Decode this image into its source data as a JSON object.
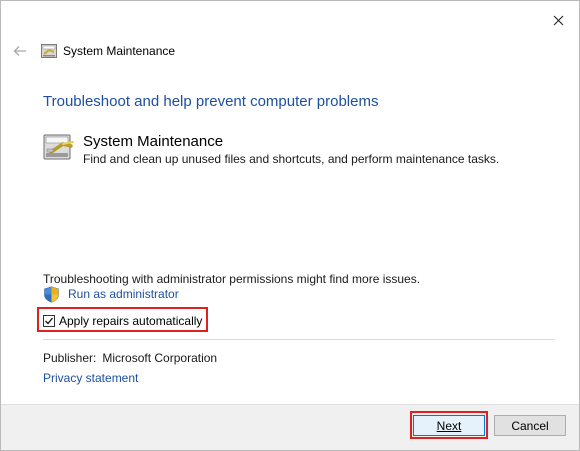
{
  "window": {
    "title": "System Maintenance",
    "close_icon": "close-icon",
    "back_icon": "back-arrow-icon"
  },
  "main": {
    "heading": "Troubleshoot and help prevent computer problems",
    "tool": {
      "name": "System Maintenance",
      "description": "Find and clean up unused files and shortcuts, and perform maintenance tasks.",
      "icon": "system-maintenance-icon"
    },
    "admin_note": "Troubleshooting with administrator permissions might find more issues.",
    "run_as_admin": "Run as administrator",
    "apply_repairs": {
      "label": "Apply repairs automatically",
      "checked": true
    },
    "publisher_label": "Publisher:",
    "publisher_value": "Microsoft Corporation",
    "privacy": "Privacy statement"
  },
  "footer": {
    "next_label": "Next",
    "cancel_label": "Cancel"
  },
  "colors": {
    "link": "#1e4fa0",
    "highlight": "#e0201f"
  }
}
